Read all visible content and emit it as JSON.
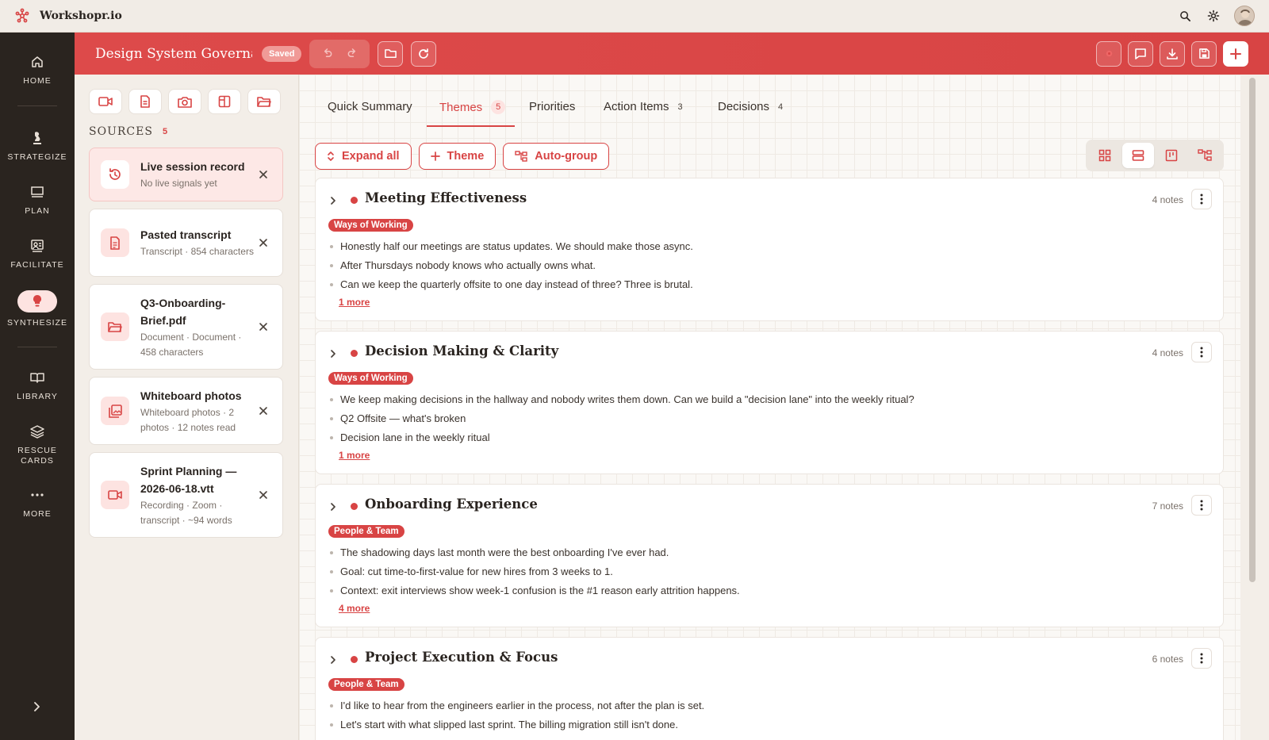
{
  "app": {
    "name": "Workshopr.io"
  },
  "header": {
    "title": "Design System Governa",
    "status": "Saved"
  },
  "nav": {
    "items": [
      {
        "label": "HOME",
        "icon": "home-icon"
      },
      {
        "label": "STRATEGIZE",
        "icon": "chess-icon"
      },
      {
        "label": "PLAN",
        "icon": "plan-icon"
      },
      {
        "label": "FACILITATE",
        "icon": "facilitate-icon"
      },
      {
        "label": "SYNTHESIZE",
        "icon": "bulb-icon"
      },
      {
        "label": "LIBRARY",
        "icon": "book-icon"
      },
      {
        "label": "RESCUE CARDS",
        "icon": "layers-icon"
      },
      {
        "label": "MORE",
        "icon": "more-icon"
      }
    ],
    "active": "SYNTHESIZE"
  },
  "sources": {
    "heading": "SOURCES",
    "count": "5",
    "items": [
      {
        "name": "Live session record",
        "sub": "No live signals yet",
        "icon": "history-icon"
      },
      {
        "name": "Pasted transcript",
        "sub": "Transcript · 854 characters",
        "icon": "document-icon"
      },
      {
        "name": "Q3-Onboarding-Brief.pdf",
        "sub": "Document · Document · 458 characters",
        "icon": "folder-icon"
      },
      {
        "name": "Whiteboard photos",
        "sub": "Whiteboard photos · 2 photos · 12 notes read",
        "icon": "photos-icon"
      },
      {
        "name": "Sprint Planning — 2026-06-18.vtt",
        "sub": "Recording · Zoom · transcript · ~94 words",
        "icon": "video-icon"
      }
    ]
  },
  "tabs": [
    {
      "label": "Quick Summary",
      "count": ""
    },
    {
      "label": "Themes",
      "count": "5"
    },
    {
      "label": "Priorities",
      "count": ""
    },
    {
      "label": "Action Items",
      "count": "3"
    },
    {
      "label": "Decisions",
      "count": "4"
    }
  ],
  "actions": {
    "expand": "Expand all",
    "theme": "Theme",
    "autogroup": "Auto-group"
  },
  "themes": [
    {
      "title": "Meeting Effectiveness",
      "notes": "4 notes",
      "tag": "Ways of Working",
      "items": [
        "Honestly half our meetings are status updates. We should make those async.",
        "After Thursdays nobody knows who actually owns what.",
        "Can we keep the quarterly offsite to one day instead of three? Three is brutal."
      ],
      "more": "1 more"
    },
    {
      "title": "Decision Making & Clarity",
      "notes": "4 notes",
      "tag": "Ways of Working",
      "items": [
        "We keep making decisions in the hallway and nobody writes them down. Can we build a \"decision lane\" into the weekly ritual?",
        "Q2 Offsite — what's broken",
        "Decision lane in the weekly ritual"
      ],
      "more": "1 more"
    },
    {
      "title": "Onboarding Experience",
      "notes": "7 notes",
      "tag": "People & Team",
      "items": [
        "The shadowing days last month were the best onboarding I've ever had.",
        "Goal: cut time-to-first-value for new hires from 3 weeks to 1.",
        "Context: exit interviews show week-1 confusion is the #1 reason early attrition happens."
      ],
      "more": "4 more"
    },
    {
      "title": "Project Execution & Focus",
      "notes": "6 notes",
      "tag": "People & Team",
      "items": [
        "I'd like to hear from the engineers earlier in the process, not after the plan is set.",
        "Let's start with what slipped last sprint. The billing migration still isn't done."
      ],
      "more": ""
    }
  ],
  "colors": {
    "accent": "#d84444",
    "nav_bg": "#2a241f",
    "tag": "#d84444"
  }
}
